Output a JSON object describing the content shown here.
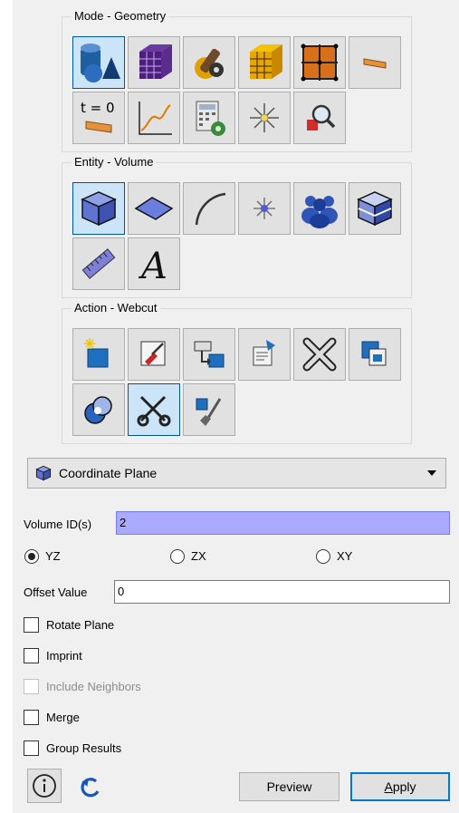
{
  "groups": {
    "mode": {
      "title": "Mode - Geometry"
    },
    "entity": {
      "title": "Entity - Volume"
    },
    "action": {
      "title": "Action - Webcut"
    }
  },
  "mode_buttons": [
    "geometry-icon",
    "mesh-icon",
    "mesh-tools-icon",
    "mesh-quality-icon",
    "boundary-conditions-icon",
    "material-icon",
    "time-zero-icon",
    "analysis-curve-icon",
    "calculator-settings-icon",
    "sensor-icon",
    "inspect-icon"
  ],
  "time_zero_label": "t = 0",
  "entity_buttons": [
    "volume-icon",
    "surface-icon",
    "curve-icon",
    "vertex-icon",
    "group-icon",
    "body-icon",
    "measure-icon",
    "text-icon"
  ],
  "text_icon_glyph": "A",
  "action_buttons": [
    "create-icon",
    "edit-icon",
    "transform-icon",
    "properties-icon",
    "delete-icon",
    "copy-icon",
    "boolean-icon",
    "webcut-icon",
    "cleanup-icon"
  ],
  "combo": {
    "icon": "volume-icon",
    "value": "Coordinate Plane"
  },
  "volume_ids": {
    "label": "Volume ID(s)",
    "value": "2"
  },
  "planes": [
    {
      "label": "YZ",
      "selected": true
    },
    {
      "label": "ZX",
      "selected": false
    },
    {
      "label": "XY",
      "selected": false
    }
  ],
  "offset": {
    "label": "Offset Value",
    "value": "0"
  },
  "checkboxes": {
    "rotate": "Rotate Plane",
    "imprint": "Imprint",
    "neighbors": "Include Neighbors",
    "merge": "Merge",
    "group": "Group Results"
  },
  "footer": {
    "preview": "Preview",
    "apply": "Apply",
    "apply_mnemonic": "A",
    "apply_rest": "pply"
  },
  "colors": {
    "selected_bg": "#cce4f7",
    "id_field_bg": "#aaaaff",
    "accent": "#0078d7"
  }
}
